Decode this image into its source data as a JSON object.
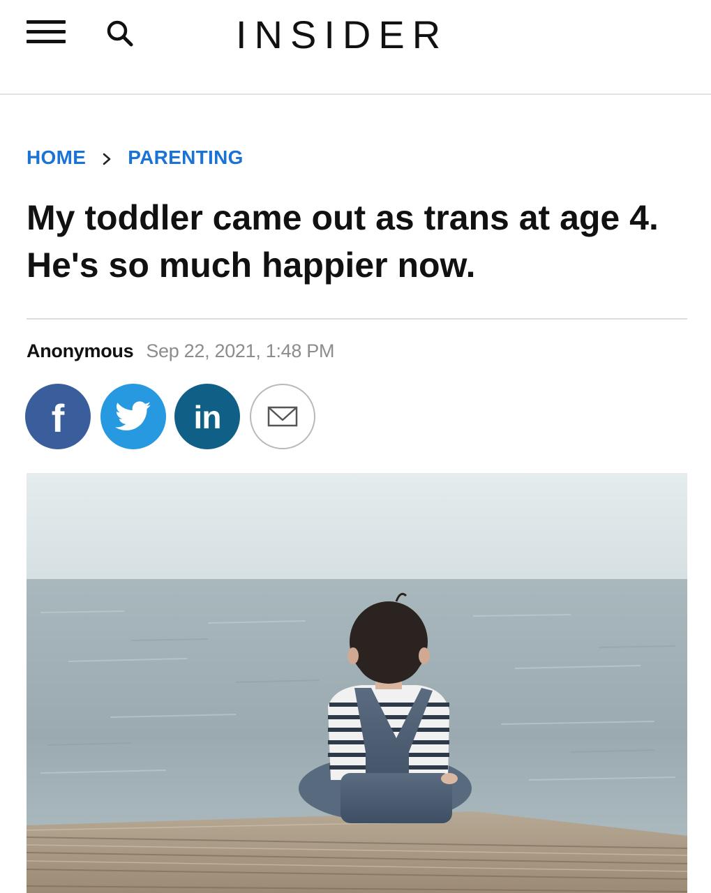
{
  "site": {
    "logo_text": "INSIDER"
  },
  "icons": {
    "menu": "hamburger-menu-icon",
    "search": "search-icon",
    "breadcrumb_separator": "chevron-right-icon",
    "facebook": "facebook-icon",
    "twitter": "twitter-icon",
    "linkedin": "linkedin-icon",
    "email": "envelope-icon"
  },
  "breadcrumb": {
    "items": [
      {
        "label": "HOME"
      },
      {
        "label": "PARENTING"
      }
    ]
  },
  "article": {
    "headline": "My toddler came out as trans at age 4. He's so much happier now.",
    "author": "Anonymous",
    "published": "Sep 22, 2021, 1:48 PM"
  },
  "share": {
    "facebook_glyph": "f",
    "linkedin_glyph": "in"
  },
  "colors": {
    "link_blue": "#1a73d6",
    "facebook": "#3a5e9c",
    "twitter": "#2799e0",
    "linkedin": "#0f5f86",
    "divider": "#dddddd",
    "meta_gray": "#8c8c8c"
  }
}
